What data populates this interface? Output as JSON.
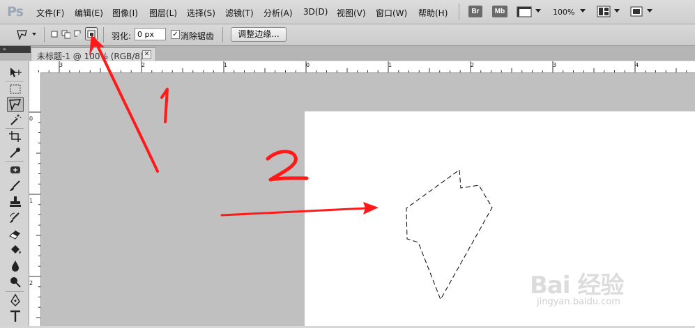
{
  "app": {
    "logo": "Ps"
  },
  "menu": [
    "文件(F)",
    "编辑(E)",
    "图像(I)",
    "图层(L)",
    "选择(S)",
    "滤镜(T)",
    "分析(A)",
    "3D(D)",
    "视图(V)",
    "窗口(W)",
    "帮助(H)"
  ],
  "menubar_buttons": {
    "bridge": "Br",
    "mini_bridge": "Mb",
    "zoom": "100%"
  },
  "options": {
    "feather_label": "羽化:",
    "feather_value": "0 px",
    "antialias_label": "消除锯齿",
    "antialias_checked": "✓",
    "refine_edge": "调整边缘..."
  },
  "tab": {
    "title": "未标题-1 @ 100% (RGB/8) *",
    "close": "✕"
  },
  "collapse": "»",
  "ruler": {
    "top_labels": [
      "3",
      "2",
      "1",
      "0",
      "1",
      "2",
      "3",
      "4"
    ],
    "left_labels": [
      "0",
      "1",
      "2"
    ]
  },
  "annotations": {
    "num1": "1",
    "num2": "2"
  },
  "watermark": {
    "brand": "Bai 经验",
    "url": "jingyan.baidu.com"
  },
  "colors": {
    "annotation_red": "#ff1a1a",
    "pasteboard": "#c0c0c0",
    "canvas": "#ffffff"
  },
  "icons": [
    "polygonal-lasso-icon",
    "move-icon",
    "marquee-icon",
    "magic-wand-icon",
    "crop-icon",
    "eyedropper-icon",
    "healing-brush-icon",
    "brush-icon",
    "clone-stamp-icon",
    "history-brush-icon",
    "eraser-icon",
    "paint-bucket-icon",
    "blur-icon",
    "dodge-icon",
    "pen-icon",
    "type-icon"
  ]
}
